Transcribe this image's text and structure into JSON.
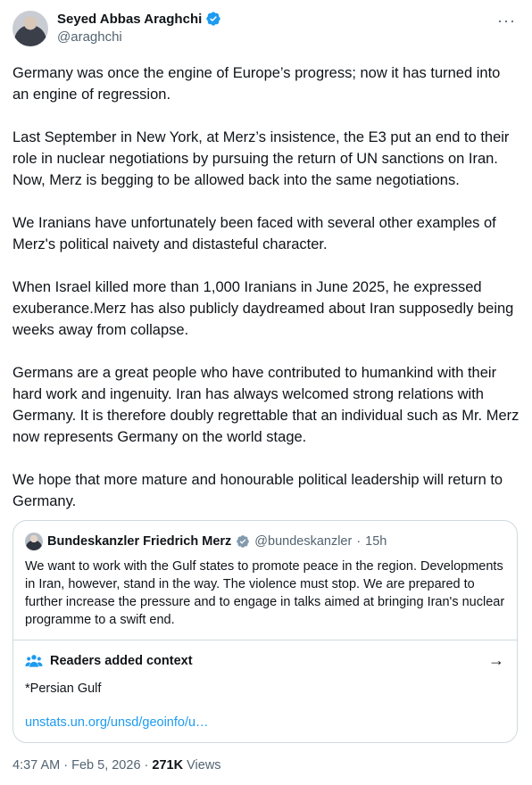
{
  "author": {
    "display_name": "Seyed Abbas Araghchi",
    "handle": "@araghchi"
  },
  "menu": {
    "more_label": "···"
  },
  "tweet": {
    "paragraphs": [
      "Germany was once the engine of Europe’s progress; now it has turned into an engine of regression.",
      "Last September in New York, at Merz’s insistence, the E3 put an end to their role in nuclear negotiations by pursuing the return of UN sanctions on Iran. Now, Merz is begging to be allowed back into the same negotiations.",
      "We Iranians have unfortunately been faced with several other examples of Merz's political naivety and distasteful character.",
      "When Israel killed more than 1,000 Iranians in June 2025, he expressed exuberance.Merz has also publicly daydreamed about Iran supposedly being weeks away from collapse.",
      "Germans are a great people who have contributed to humankind with their hard work and ingenuity. Iran has always welcomed strong relations with Germany. It is therefore doubly regrettable that an individual such as Mr. Merz now represents Germany on the world stage.",
      "We hope that more mature and honourable political leadership will return to Germany."
    ]
  },
  "quote": {
    "display_name": "Bundeskanzler Friedrich Merz",
    "handle": "@bundeskanzler",
    "separator": "·",
    "time": "15h",
    "text": "We want to work with the Gulf states to promote peace in the region. Developments in Iran, however, stand in the way. The violence must stop. We are prepared to further increase the pressure and to engage in talks aimed at bringing Iran's nuclear programme to a swift end."
  },
  "context": {
    "title": "Readers added context",
    "note": "*Persian Gulf",
    "link": "unstats.un.org/unsd/geoinfo/u…",
    "arrow": "→"
  },
  "footer": {
    "time": "4:37 AM",
    "separator1": "·",
    "date": "Feb 5, 2026",
    "separator2": "·",
    "views_count": "271K",
    "views_label": "Views"
  },
  "colors": {
    "verified_blue": "#1d9bf0",
    "government_grey": "#829aab",
    "link": "#1d9bf0",
    "secondary_text": "#536471",
    "border": "#cfd9de"
  },
  "icons": [
    "verified-badge-icon",
    "government-badge-icon",
    "people-icon",
    "arrow-right-icon",
    "more-options-icon"
  ]
}
